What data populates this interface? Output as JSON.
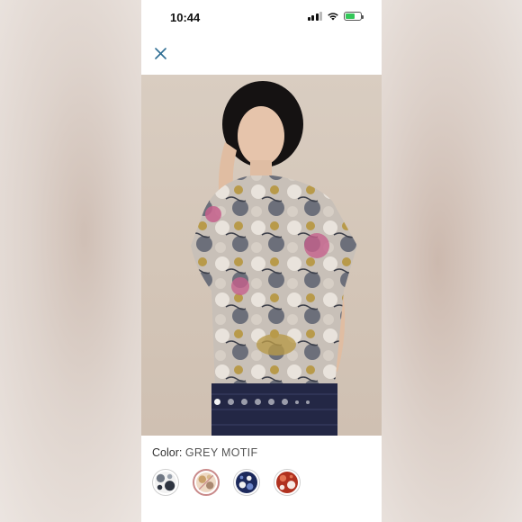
{
  "status_bar": {
    "time": "10:44"
  },
  "product": {
    "color_label": "Color:",
    "color_value": "GREY MOTIF",
    "image_count": 8,
    "active_image_index": 0
  },
  "swatches": [
    {
      "name": "grey-motif",
      "colors": [
        "#f2f2f2",
        "#6f7783",
        "#2e3440"
      ]
    },
    {
      "name": "neutral-motif",
      "colors": [
        "#eed9c4",
        "#c9a06a",
        "#a98870"
      ],
      "selected": true,
      "unavailable": true
    },
    {
      "name": "navy-motif",
      "colors": [
        "#1d2a5c",
        "#f1f1f1",
        "#6d86c9"
      ]
    },
    {
      "name": "red-motif",
      "colors": [
        "#b0311f",
        "#e37352",
        "#f7e9e3"
      ]
    }
  ],
  "accent_colors": {
    "close_icon": "#2f6e93",
    "selected_swatch_ring": "#c98a8a"
  }
}
